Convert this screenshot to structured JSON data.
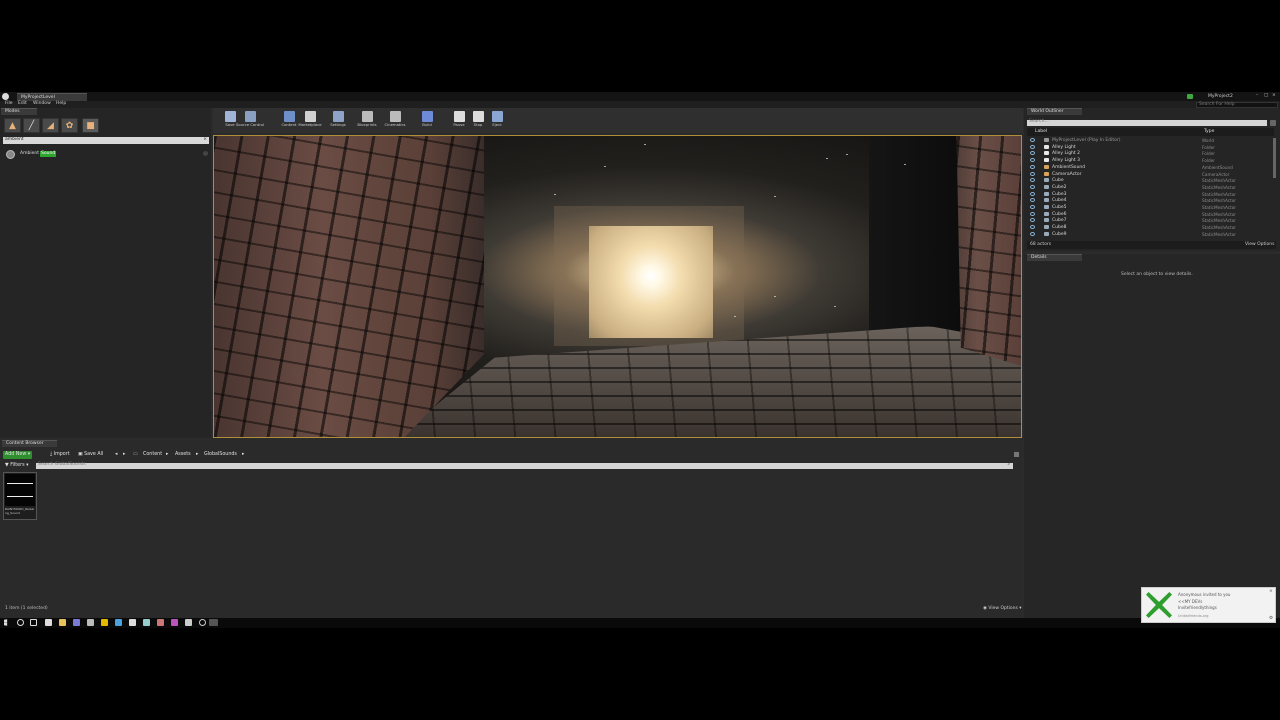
{
  "window": {
    "tab_title": "MyProjectLevel",
    "project_name": "MyProject2",
    "search_help_placeholder": "Search For Help"
  },
  "menu": [
    "File",
    "Edit",
    "Window",
    "Help"
  ],
  "modes": {
    "tab_label": "Modes",
    "search_value": "ambient",
    "result_prefix": "Ambient",
    "result_highlight": "Sound"
  },
  "toolbar": {
    "buttons": [
      "Save",
      "Source Control",
      "Content",
      "Marketplace",
      "Settings",
      "Blueprints",
      "Cinematics",
      "Build",
      "Pause",
      "Stop",
      "Eject"
    ]
  },
  "outliner": {
    "tab_label": "World Outliner",
    "search_placeholder": "Search...",
    "col_label": "Label",
    "col_type": "Type",
    "rows": [
      {
        "name": "MyProjectLevel (Play In Editor)",
        "type": "World"
      },
      {
        "name": "Alley Light",
        "type": "Folder"
      },
      {
        "name": "Alley Light 2",
        "type": "Folder"
      },
      {
        "name": "Alley Light 3",
        "type": "Folder"
      },
      {
        "name": "AmbientSound",
        "type": "AmbientSound"
      },
      {
        "name": "CameraActor",
        "type": "CameraActor"
      },
      {
        "name": "Cube",
        "type": "StaticMeshActor"
      },
      {
        "name": "Cube2",
        "type": "StaticMeshActor"
      },
      {
        "name": "Cube3",
        "type": "StaticMeshActor"
      },
      {
        "name": "Cube4",
        "type": "StaticMeshActor"
      },
      {
        "name": "Cube5",
        "type": "StaticMeshActor"
      },
      {
        "name": "Cube6",
        "type": "StaticMeshActor"
      },
      {
        "name": "Cube7",
        "type": "StaticMeshActor"
      },
      {
        "name": "Cube8",
        "type": "StaticMeshActor"
      },
      {
        "name": "Cube9",
        "type": "StaticMeshActor"
      }
    ],
    "actor_count": "68 actors",
    "view_options": "View Options"
  },
  "details": {
    "tab_label": "Details",
    "empty_message": "Select an object to view details."
  },
  "content_browser": {
    "tab_label": "Content Browser",
    "add_new": "Add New",
    "import": "Import",
    "save_all": "Save All",
    "path": [
      "Content",
      "Assets",
      "GlobalSounds"
    ],
    "search_placeholder": "Search GlobalSounds",
    "filters": "Filters",
    "asset_name": "RAINYMOOD_Relaxing_Sound",
    "status": "1 item (1 selected)",
    "view_options": "View Options"
  },
  "notification": {
    "line1": "Anonymous invited to you",
    "line2": "<<MY DEVs",
    "line3": "Invitefriendlythings",
    "line4": "Unitedfriends.org"
  },
  "colors": {
    "accent_green": "#4caf2e",
    "viewport_border": "#b08f3a",
    "highlight_green": "#2ea52e"
  }
}
